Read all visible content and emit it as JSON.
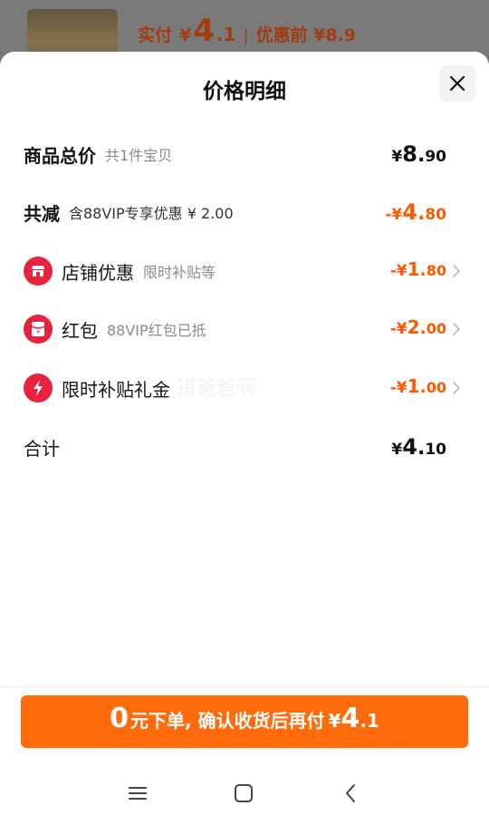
{
  "backdrop": {
    "paid_label": "实付",
    "paid_yen": "¥",
    "paid_int": "4",
    "paid_dec": ".1",
    "separator": "|",
    "original_price": "优惠前 ¥8.9"
  },
  "sheet": {
    "title": "价格明细",
    "close_icon": "close-icon"
  },
  "rows": {
    "total": {
      "label": "商品总价",
      "sub": "共1件宝贝",
      "yen": "¥",
      "int": "8",
      "dot": ".",
      "dec": "90"
    },
    "discount": {
      "label": "共减",
      "sub": "含88VIP专享优惠 ¥ 2.00",
      "prefix": "-",
      "yen": "¥",
      "int": "4",
      "dot": ".",
      "dec": "80"
    },
    "shop": {
      "label": "店铺优惠",
      "sub": "限时补贴等",
      "prefix": "-",
      "yen": "¥",
      "int": "1",
      "dot": ".",
      "dec": "80",
      "icon": "shop-icon"
    },
    "redpacket": {
      "label": "红包",
      "sub": "88VIP红包已抵",
      "prefix": "-",
      "yen": "¥",
      "int": "2",
      "dot": ".",
      "dec": "00",
      "icon": "red-packet-icon"
    },
    "subsidy": {
      "label": "限时补贴礼金",
      "prefix": "-",
      "yen": "¥",
      "int": "1",
      "dot": ".",
      "dec": "00",
      "icon": "lightning-icon"
    },
    "sum": {
      "label": "合计",
      "yen": "¥",
      "int": "4",
      "dot": ".",
      "dec": "10"
    }
  },
  "watermark": "猎爸爸啊",
  "cta": {
    "zero": "0",
    "text": "元下单, 确认收货后再付",
    "yen": "¥",
    "int": "4",
    "dec": ".1"
  },
  "colors": {
    "accent_orange": "#ff5a00",
    "cta_bg": "#ff6b0a",
    "icon_red": "#e8213c"
  },
  "navbar": {
    "menu_icon": "menu-icon",
    "home_icon": "home-icon",
    "back_icon": "back-icon"
  }
}
